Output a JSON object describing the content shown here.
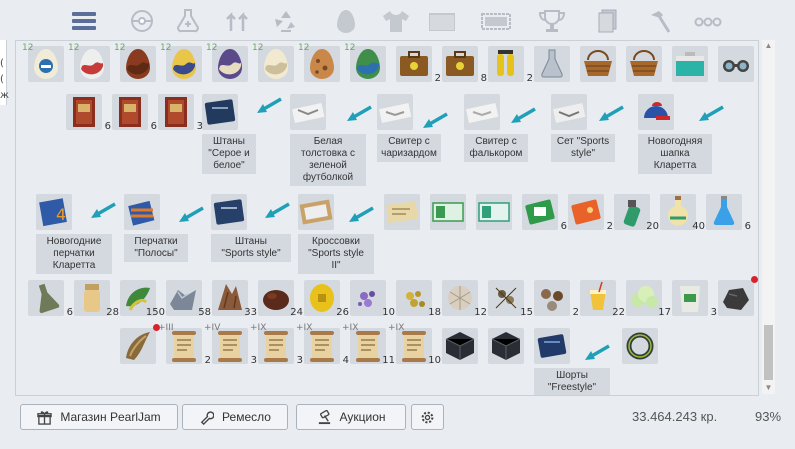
{
  "left_edge_chars": [
    "(",
    "(",
    "ж"
  ],
  "tabs": [
    "list-icon",
    "pokeball-icon",
    "potion-icon",
    "upgrade-arrows-icon",
    "recycle-icon",
    "egg-icon",
    "shirt-icon",
    "folder-icon",
    "ticket-icon",
    "trophy-icon",
    "cards-icon",
    "hammer-icon",
    "more-icon"
  ],
  "items": [
    {
      "icon": "repel-egg",
      "lvl": "12"
    },
    {
      "icon": "red-white-egg",
      "lvl": "12"
    },
    {
      "icon": "brown-egg",
      "lvl": "12"
    },
    {
      "icon": "yellow-blue-egg",
      "lvl": "12"
    },
    {
      "icon": "purple-egg",
      "lvl": "12"
    },
    {
      "icon": "cream-egg",
      "lvl": "12"
    },
    {
      "icon": "spotted-egg",
      "lvl": "12"
    },
    {
      "icon": "green-blue-egg",
      "lvl": "12"
    },
    {
      "icon": "case-icon",
      "count": "2"
    },
    {
      "icon": "case-icon",
      "count": "8"
    },
    {
      "icon": "scuba-tank-icon",
      "count": "2"
    },
    {
      "icon": "flask-icon"
    },
    {
      "icon": "basket-icon"
    },
    {
      "icon": "basket-icon"
    },
    {
      "icon": "cooler-box-icon"
    },
    {
      "icon": "goggles-icon"
    },
    {
      "icon": "book-icon",
      "count": "6"
    },
    {
      "icon": "book-icon",
      "count": "6"
    },
    {
      "icon": "book-icon",
      "count": "3"
    },
    {
      "icon": "pants-gray-white-icon"
    },
    {
      "icon": "hoodie-charizard-icon"
    },
    {
      "icon": "sweater-charizard-icon"
    },
    {
      "icon": "sweater-falkor-icon"
    },
    {
      "icon": "sports-style-set-icon"
    },
    {
      "icon": "christmas-cap-icon"
    },
    {
      "icon": "christmas-gloves-icon"
    },
    {
      "icon": "striped-gloves-icon"
    },
    {
      "icon": "sports-pants-icon"
    },
    {
      "icon": "sneakers-box-icon"
    },
    {
      "icon": "ticket-paper-icon"
    },
    {
      "icon": "green-ticket-icon"
    },
    {
      "icon": "green-ticket-2-icon"
    },
    {
      "icon": "green-card-icon",
      "count": "6"
    },
    {
      "icon": "orange-card-icon",
      "count": "2"
    },
    {
      "icon": "spray-icon",
      "count": "20"
    },
    {
      "icon": "potion-bottle-icon",
      "count": "40"
    },
    {
      "icon": "blue-flask-icon",
      "count": "6"
    },
    {
      "icon": "stone-flask-icon",
      "count": "6"
    },
    {
      "icon": "jar-icon",
      "count": "28"
    },
    {
      "icon": "leaves-icon",
      "count": "150"
    },
    {
      "icon": "ore-icon",
      "count": "58"
    },
    {
      "icon": "bark-icon",
      "count": "33"
    },
    {
      "icon": "dark-stone-icon",
      "count": "24"
    },
    {
      "icon": "gold-coin-icon",
      "count": "26"
    },
    {
      "icon": "purple-dust-icon",
      "count": "10"
    },
    {
      "icon": "yellow-dust-icon",
      "count": "18"
    },
    {
      "icon": "web-icon",
      "count": "12"
    },
    {
      "icon": "seeds-icon",
      "count": "15"
    },
    {
      "icon": "parts-icon",
      "count": "2"
    },
    {
      "icon": "juice-icon",
      "count": "22"
    },
    {
      "icon": "cloud-icon",
      "count": "17"
    },
    {
      "icon": "sack-icon",
      "count": "3"
    },
    {
      "icon": "coal-icon"
    },
    {
      "icon": "tooth-icon"
    },
    {
      "icon": "scroll-icon",
      "count": "2",
      "plus": "+III"
    },
    {
      "icon": "scroll-icon",
      "count": "3",
      "plus": "+IV"
    },
    {
      "icon": "scroll-icon",
      "count": "3",
      "plus": "+IX"
    },
    {
      "icon": "scroll-icon",
      "count": "4",
      "plus": "+IX"
    },
    {
      "icon": "scroll-icon",
      "count": "11",
      "plus": "+IX"
    },
    {
      "icon": "scroll-icon",
      "count": "10",
      "plus": "+IX"
    },
    {
      "icon": "dark-box-icon"
    },
    {
      "icon": "dark-box-icon"
    },
    {
      "icon": "shorts-freestyle-icon"
    },
    {
      "icon": "bracelet-icon"
    }
  ],
  "labels": [
    "Штаны\n\"Серое и\nбелое\"",
    "Белая\nтолстовка с\nзеленой\nфутболкой",
    "Свитер с\nчаризардом",
    "Свитер с\nфалькором",
    "Сет \"Sports\nstyle\"",
    "Новогодняя\nшапка\nКларетта",
    "Новогодние\nперчатки\nКларетта",
    "Перчатки\n\"Полосы\"",
    "Штаны\n\"Sports style\"",
    "Кроссовки\n\"Sports style\nII\"",
    "Шорты\n\"Freestyle\""
  ],
  "bottom": {
    "shop_label": "Магазин PearlJam",
    "craft_label": "Ремесло",
    "auction_label": "Аукцион",
    "money": "33.464.243 кр.",
    "percent": "93%"
  },
  "colors": {
    "accent_arrow": "#1fa0b8",
    "badge_red": "#d9222a",
    "level_green": "#6aa85a"
  }
}
